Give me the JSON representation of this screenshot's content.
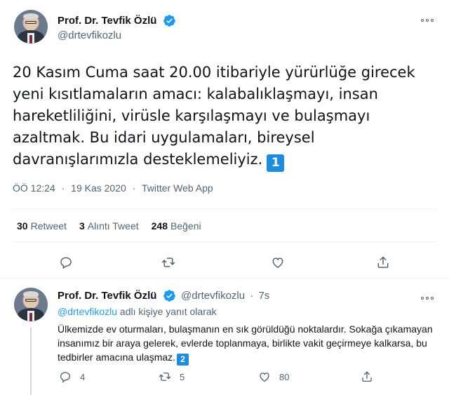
{
  "main_tweet": {
    "author_name": "Prof. Dr. Tevfik Özlü",
    "author_handle": "@drtevfikozlu",
    "text": "20 Kasım Cuma saat 20.00 itibariyle yürürlüğe girecek yeni kısıtlamaların amacı: kalabalıklaşmayı, insan hareketliliğini, virüsle karşılaşmayı ve bulaşmayı azaltmak. Bu idari uygulamaları, bireysel davranışlarımızla desteklemeliyiz.",
    "emoji_number": "1",
    "time": "ÖÖ 12:24",
    "separator": "·",
    "date": "19 Kas 2020",
    "source": "Twitter Web App",
    "stats": {
      "retweets_count": "30",
      "retweets_label": "Retweet",
      "quotes_count": "3",
      "quotes_label": "Alıntı Tweet",
      "likes_count": "248",
      "likes_label": "Beğeni"
    },
    "icons": [
      "reply-icon",
      "retweet-icon",
      "like-icon",
      "share-icon",
      "more-icon",
      "verified-badge-icon"
    ]
  },
  "reply_tweet": {
    "author_name": "Prof. Dr. Tevfik Özlü",
    "author_handle": "@drtevfikozlu",
    "separator": "·",
    "age": "7s",
    "replying_to_handle": "@drtevfikozlu",
    "replying_to_suffix": "adlı kişiye yanıt olarak",
    "text": "Ülkemizde ev oturmaları, bulaşmanın en sık görüldüğü noktalardır. Sokağa çıkamayan insanımız bir araya gelerek, evlerde toplanmaya, birlikte vakit geçirmeye kalkarsa, bu tedbirler amacına ulaşmaz.",
    "emoji_number": "2",
    "counts": {
      "replies": "4",
      "retweets": "5",
      "likes": "80"
    }
  },
  "colors": {
    "text": "#0f1419",
    "secondary": "#536471",
    "accent": "#1d9bf0",
    "divider": "#eff3f4"
  }
}
